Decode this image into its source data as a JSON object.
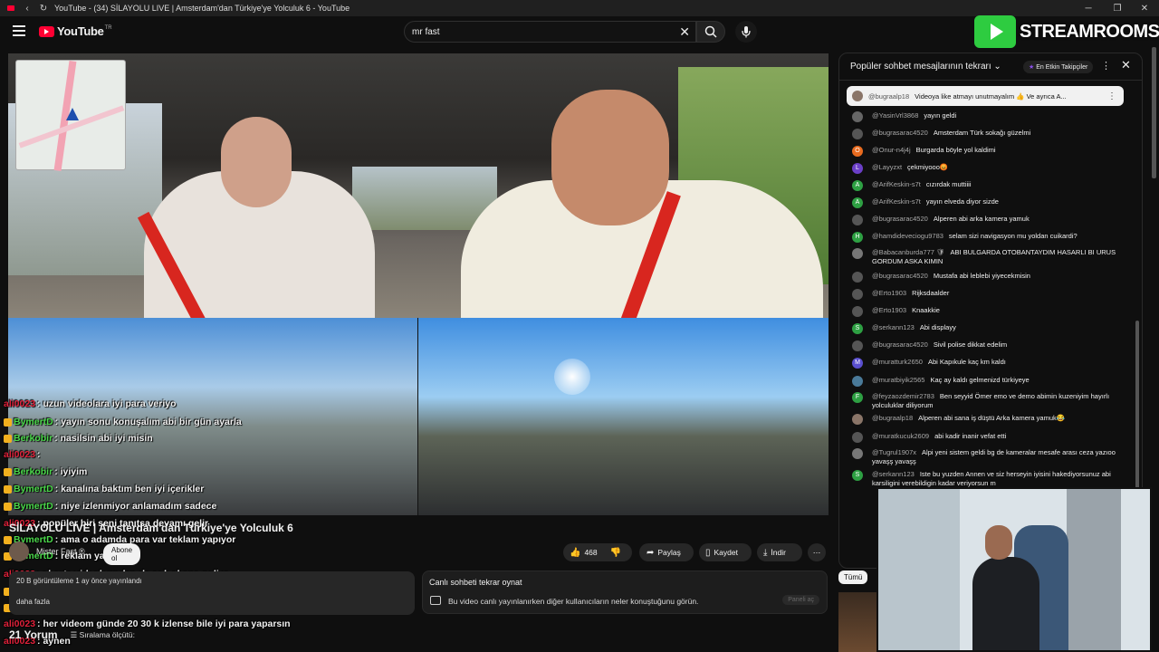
{
  "window": {
    "title": "YouTube - (34) SİLAYOLU LIVE | Amsterdam'dan Türkiye'ye Yolculuk 6 - YouTube"
  },
  "masthead": {
    "logo": "YouTube",
    "country": "TR",
    "search_value": "mr fast"
  },
  "brand": {
    "overlay_logo": "STREAMROOMS",
    "accent": "#2ecc40"
  },
  "stream_chat_overlay": [
    {
      "user": "ali0023",
      "text": ": uzun videolara iyi para veriyo",
      "color": "#e0213a"
    },
    {
      "user": "BymertD",
      "text": ": yayın sonu konuşalım abi bir gün ayarla",
      "color": "#4bd94b"
    },
    {
      "user": "Berkobir",
      "text": ": nasilsin abi iyi misin",
      "color": "#4bd94b"
    },
    {
      "user": "ali0023",
      "text": ":",
      "color": "#e0213a"
    },
    {
      "user": "Berkobir",
      "text": ": iyiyim",
      "color": "#4bd94b"
    },
    {
      "user": "BymertD",
      "text": ": kanalına baktım ben iyi içerikler",
      "color": "#4bd94b"
    },
    {
      "user": "BymertD",
      "text": ": niye izlenmiyor anlamadım sadece",
      "color": "#4bd94b"
    },
    {
      "user": "ali0023",
      "text": ": popüler biri seni tanıtsa devamı gelir",
      "color": "#e0213a"
    },
    {
      "user": "BymertD",
      "text": ": ama o adamda para var teklam yapıyor",
      "color": "#4bd94b"
    },
    {
      "user": "BymertD",
      "text": ": reklam yapıyor",
      "color": "#4bd94b"
    },
    {
      "user": "ali0023",
      "text": ": shorts videolarından da çok abone geliyo",
      "color": "#e0213a"
    },
    {
      "user": "BymertD",
      "text": ": reklam bütçen varmı burak abi",
      "color": "#4bd94b"
    },
    {
      "user": "BymertD",
      "text": ": daha degil abi",
      "color": "#4bd94b"
    },
    {
      "user": "ali0023",
      "text": ": her videom günde 20 30 k izlense bile iyi para yaparsın",
      "color": "#e0213a"
    },
    {
      "user": "ali0023",
      "text": ": aynen",
      "color": "#e0213a"
    }
  ],
  "video": {
    "title": "SİLAYOLU LIVE | Amsterdam'dan Türkiye'ye Yolculuk 6",
    "channel": "Mister Fast ®",
    "subscribe_label": "Abone ol",
    "likes": "468",
    "share_label": "Paylaş",
    "save_label": "Kaydet",
    "download_label": "İndir",
    "more_label": "⋯",
    "views": "20 B görüntüleme  1 ay önce yayınlandı",
    "more_text": "daha fazla"
  },
  "comments": {
    "count": "21 Yorum",
    "sort_label": "Sıralama ölçütü:"
  },
  "replay": {
    "title": "Canlı sohbeti tekrar oynat",
    "description": "Bu video canlı yayınlanırken diğer kullanıcıların neler konuştuğunu görün.",
    "button": "Paneli aç"
  },
  "live_chat": {
    "header": "Popüler sohbet mesajlarının tekrarı",
    "badge": "En Etkin Takipçiler",
    "pinned": {
      "user": "@bugraalp18",
      "text": "Videoya like atmayı unutmayalım 👍 Ve ayrıca A..."
    },
    "messages": [
      {
        "initial": "",
        "color": "#666",
        "user": "@YasinVrl3868",
        "text": "yayın geldi"
      },
      {
        "initial": "",
        "color": "#555",
        "user": "@bugrasarac4520",
        "text": "Amsterdam Türk sokağı güzelmi"
      },
      {
        "initial": "O",
        "color": "#e86b1f",
        "user": "@Onur-n4j4j",
        "text": "Burgarda böyle yol kaldimi"
      },
      {
        "initial": "L",
        "color": "#6b3fc7",
        "user": "@Layyzxt",
        "text": "çekmiyooo😡"
      },
      {
        "initial": "A",
        "color": "#2ea043",
        "user": "@ArifKeskin-s7t",
        "text": "cızırdak muttiiii"
      },
      {
        "initial": "A",
        "color": "#2ea043",
        "user": "@ArifKeskin-s7t",
        "text": "yayın elveda diyor sizde"
      },
      {
        "initial": "",
        "color": "#555",
        "user": "@bugrasarac4520",
        "text": "Alperen abi arka kamera yamuk"
      },
      {
        "initial": "H",
        "color": "#2ea043",
        "user": "@hamdideveciogu9783",
        "text": "selam sizi navigasyon mu yoldan cuikardi?"
      },
      {
        "initial": "",
        "color": "#777",
        "user": "@Babacanburda777 🛡",
        "text": "ABI BULGARDA OTOBANTAYDIM HASARLI BI URUS GORDUM ASKA KIMIN"
      },
      {
        "initial": "",
        "color": "#555",
        "user": "@bugrasarac4520",
        "text": "Mustafa abi leblebi yiyecekmisin"
      },
      {
        "initial": "",
        "color": "#555",
        "user": "@Erto1903",
        "text": "Rijksdaalder"
      },
      {
        "initial": "",
        "color": "#555",
        "user": "@Erto1903",
        "text": "Knaakkie"
      },
      {
        "initial": "S",
        "color": "#2ea043",
        "user": "@serkann123",
        "text": "Abi displayy"
      },
      {
        "initial": "",
        "color": "#555",
        "user": "@bugrasarac4520",
        "text": "Sivil polise dikkat edelim"
      },
      {
        "initial": "M",
        "color": "#5a4fcf",
        "user": "@muratturk2650",
        "text": "Abi Kapıkule kaç km kaldı"
      },
      {
        "initial": "",
        "color": "#4a7a99",
        "user": "@muratbiyik2565",
        "text": "Kaç ay kaldı gelmenizd türkiyeye"
      },
      {
        "initial": "F",
        "color": "#2ea043",
        "user": "@feyzaozdemir2783",
        "text": "Ben seyyid Ömer emo ve demo abimin kuzeniyim hayırlı yolculuklar diliyorum"
      },
      {
        "initial": "",
        "color": "#8a7568",
        "user": "@bugraalp18",
        "text": "Alperen abi sana iş düştü Arka kamera yamuk😂"
      },
      {
        "initial": "",
        "color": "#555",
        "user": "@muratkucuk2609",
        "text": "abi kadir inanir vefat etti"
      },
      {
        "initial": "",
        "color": "#777",
        "user": "@Tugrul1907x",
        "text": "Alpi yeni sistem geldi bg de kameralar mesafe arası ceza yazıoo yavaşş yavaşş"
      },
      {
        "initial": "S",
        "color": "#2ea043",
        "user": "@serkann123",
        "text": "Iste bu yuzden Annen ve siz herseyin iyisini hakediyorsunuz abi karsiligini verebildigin kadar veriyorsun m"
      }
    ],
    "tab_all": "Tümü"
  }
}
